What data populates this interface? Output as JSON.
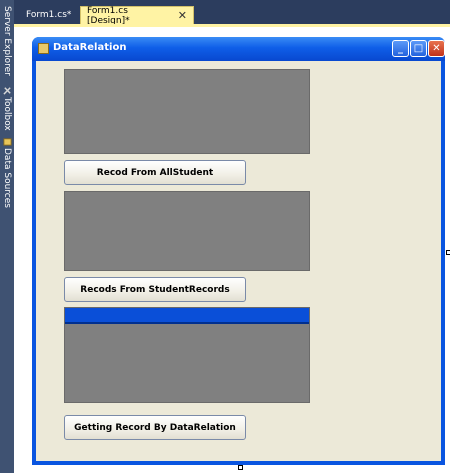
{
  "sidebar": {
    "items": [
      {
        "label": "Server Explorer",
        "icon": "server-explorer-icon"
      },
      {
        "label": "Toolbox",
        "icon": "toolbox-icon"
      },
      {
        "label": "Data Sources",
        "icon": "data-sources-icon"
      }
    ]
  },
  "tabs": [
    {
      "label": "Form1.cs*",
      "active": false
    },
    {
      "label": "Form1.cs [Design]*",
      "active": true,
      "close": "✕"
    }
  ],
  "form": {
    "title": "DataRelation",
    "minimize": "_",
    "maximize": "□",
    "close": "✕"
  },
  "buttons": {
    "all_student": "Recod From AllStudent",
    "student_records": "Recods From StudentRecords",
    "data_relation": "Getting Record By DataRelation"
  },
  "colors": {
    "titlebar": "#0a55e0",
    "client": "#ece9d8",
    "grid": "#808080",
    "tab_active": "#fff3a4"
  }
}
